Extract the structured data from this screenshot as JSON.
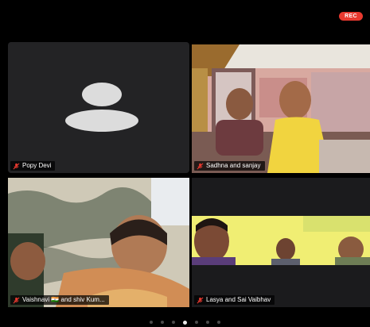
{
  "status": {
    "rec_label": "REC"
  },
  "participants": [
    {
      "name": "Popy Devi",
      "muted": true,
      "video": false
    },
    {
      "name": "Sadhna and sanjay",
      "muted": true,
      "video": true
    },
    {
      "name": "Vaishnavi 🇮🇳 and shiv Kum...",
      "muted": true,
      "video": true
    },
    {
      "name": "Lasya and Sai Vaibhav",
      "muted": true,
      "video": true
    }
  ],
  "pager": {
    "total_pages": 7,
    "active_index": 3
  },
  "colors": {
    "rec_badge": "#e8392f",
    "muted_mic": "#e8392f",
    "background": "#000000"
  }
}
